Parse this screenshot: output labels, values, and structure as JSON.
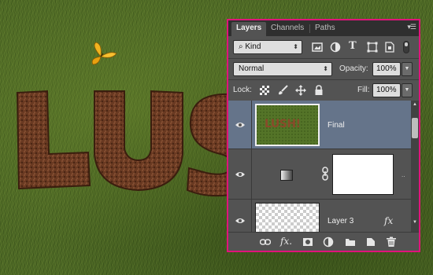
{
  "canvas": {
    "artwork_text": "LUS",
    "thumbnail_text": "LUSH!",
    "butterfly_color": "#f0b020"
  },
  "panel": {
    "border_color": "#e0147a",
    "tabs": [
      {
        "label": "Layers",
        "active": true
      },
      {
        "label": "Channels",
        "active": false
      },
      {
        "label": "Paths",
        "active": false
      }
    ],
    "filter": {
      "kind_label": "Kind"
    },
    "blend_mode": "Normal",
    "opacity_label": "Opacity:",
    "opacity_value": "100%",
    "lock_label": "Lock:",
    "fill_label": "Fill:",
    "fill_value": "100%",
    "layers": [
      {
        "name": "Final",
        "selected": true,
        "visible": true
      },
      {
        "name": "",
        "selected": false,
        "visible": true,
        "type": "adjustment-gradient"
      },
      {
        "name": "Layer 3",
        "selected": false,
        "visible": true,
        "fx": "fx"
      }
    ],
    "bottom_icons": [
      "link-icon",
      "fx-icon",
      "mask-icon",
      "adjustment-icon",
      "folder-icon",
      "new-layer-icon",
      "trash-icon"
    ]
  }
}
